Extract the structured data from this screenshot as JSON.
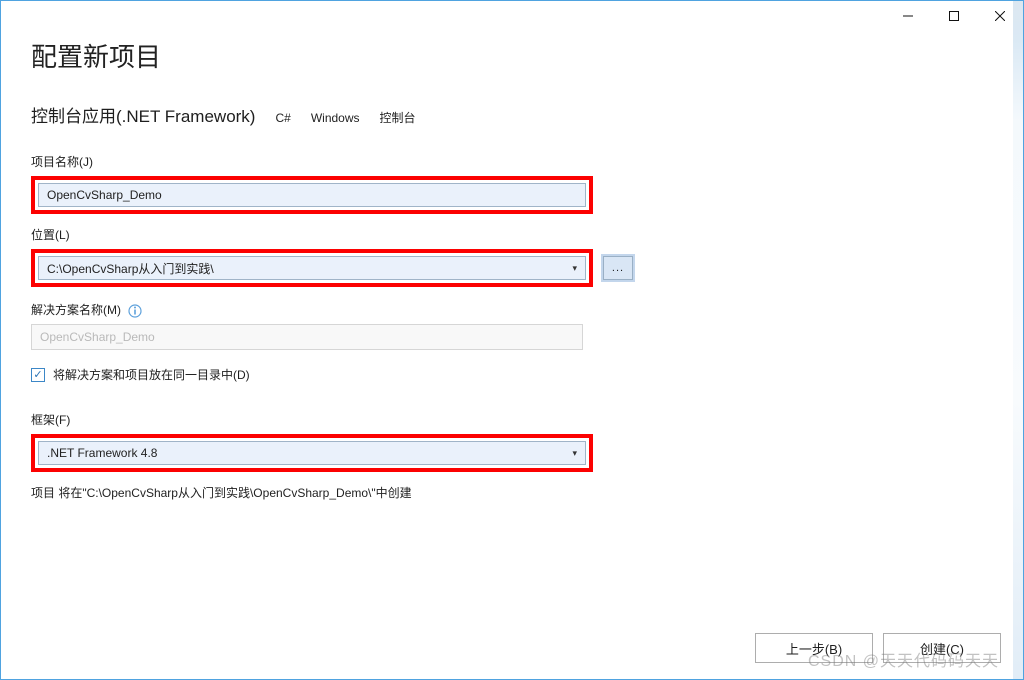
{
  "window": {
    "title": ""
  },
  "header": {
    "page_title": "配置新项目",
    "project_type": "控制台应用(.NET Framework)",
    "tags": [
      "C#",
      "Windows",
      "控制台"
    ]
  },
  "fields": {
    "project_name": {
      "label": "项目名称(J)",
      "value": "OpenCvSharp_Demo"
    },
    "location": {
      "label": "位置(L)",
      "value": "C:\\OpenCvSharp从入门到实践\\",
      "browse_label": "..."
    },
    "solution_name": {
      "label": "解决方案名称(M)",
      "placeholder": "OpenCvSharp_Demo"
    },
    "same_dir_checkbox": {
      "label": "将解决方案和项目放在同一目录中(D)",
      "checked": true
    },
    "framework": {
      "label": "框架(F)",
      "value": ".NET Framework 4.8"
    },
    "hint": "项目 将在\"C:\\OpenCvSharp从入门到实践\\OpenCvSharp_Demo\\\"中创建"
  },
  "footer": {
    "back_label": "上一步(B)",
    "create_label": "创建(C)"
  },
  "watermark": "CSDN @天天代码码天天"
}
